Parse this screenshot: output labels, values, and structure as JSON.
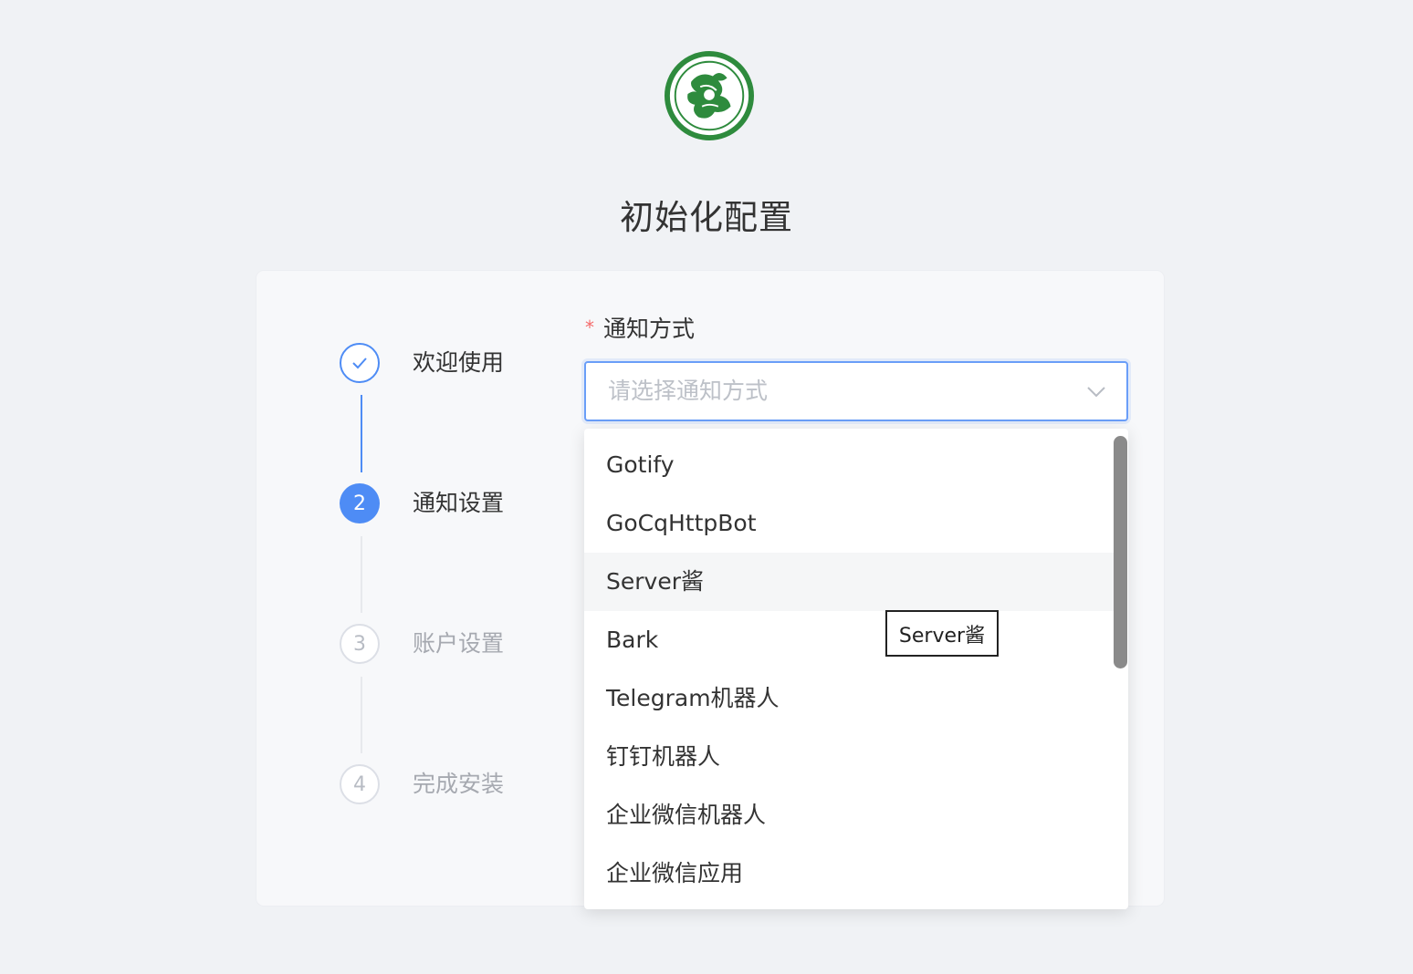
{
  "page": {
    "title": "初始化配置"
  },
  "logo": {
    "icon": "qilin-seal-logo",
    "color": "#2e8b3d"
  },
  "steps": [
    {
      "number": "1",
      "label": "欢迎使用",
      "status": "done",
      "icon": "check-icon"
    },
    {
      "number": "2",
      "label": "通知设置",
      "status": "active"
    },
    {
      "number": "3",
      "label": "账户设置",
      "status": "todo"
    },
    {
      "number": "4",
      "label": "完成安装",
      "status": "todo"
    }
  ],
  "form": {
    "required_mark": "*",
    "label": "通知方式",
    "select": {
      "placeholder": "请选择通知方式",
      "icon": "chevron-down-icon"
    }
  },
  "dropdown": {
    "options": [
      {
        "label": "Gotify"
      },
      {
        "label": "GoCqHttpBot"
      },
      {
        "label": "Server酱",
        "hovered": true
      },
      {
        "label": "Bark"
      },
      {
        "label": "Telegram机器人"
      },
      {
        "label": "钉钉机器人"
      },
      {
        "label": "企业微信机器人"
      },
      {
        "label": "企业微信应用"
      }
    ]
  },
  "tooltip": {
    "text": "Server酱"
  },
  "colors": {
    "accent": "#4e8cf5",
    "required": "#f56c6c"
  }
}
